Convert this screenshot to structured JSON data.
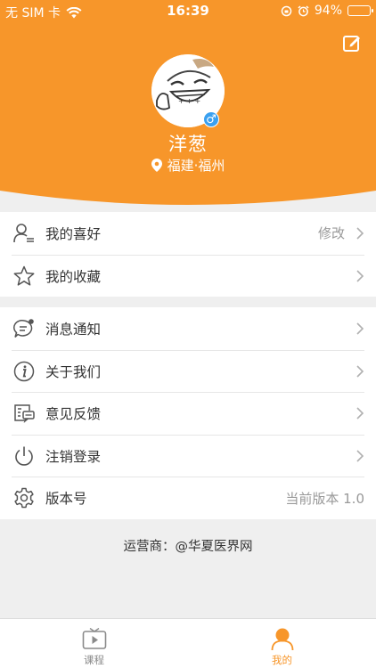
{
  "status_bar": {
    "carrier": "无 SIM 卡",
    "time": "16:39",
    "battery_percent": "94%",
    "battery_level": 0.94
  },
  "colors": {
    "accent": "#f7962a",
    "gender_badge": "#3aa0ef",
    "background": "#efefef"
  },
  "profile": {
    "name": "洋葱",
    "gender_symbol": "♂",
    "location": "福建·福州",
    "edit_icon": "edit-icon",
    "avatar": "cartoon-avatar"
  },
  "menu_group_1": [
    {
      "label": "我的喜好",
      "icon": "user-list-icon",
      "value": "修改"
    },
    {
      "label": "我的收藏",
      "icon": "star-icon",
      "value": ""
    }
  ],
  "menu_group_2": [
    {
      "label": "消息通知",
      "icon": "message-icon",
      "value": ""
    },
    {
      "label": "关于我们",
      "icon": "info-icon",
      "value": ""
    },
    {
      "label": "意见反馈",
      "icon": "feedback-icon",
      "value": ""
    },
    {
      "label": "注销登录",
      "icon": "power-icon",
      "value": ""
    },
    {
      "label": "版本号",
      "icon": "gear-icon",
      "value": "当前版本 1.0"
    }
  ],
  "footer": {
    "operator": "运营商：@华夏医界网"
  },
  "tabbar": [
    {
      "label": "课程",
      "icon": "tv-play-icon",
      "active": false
    },
    {
      "label": "我的",
      "icon": "person-icon",
      "active": true
    }
  ]
}
